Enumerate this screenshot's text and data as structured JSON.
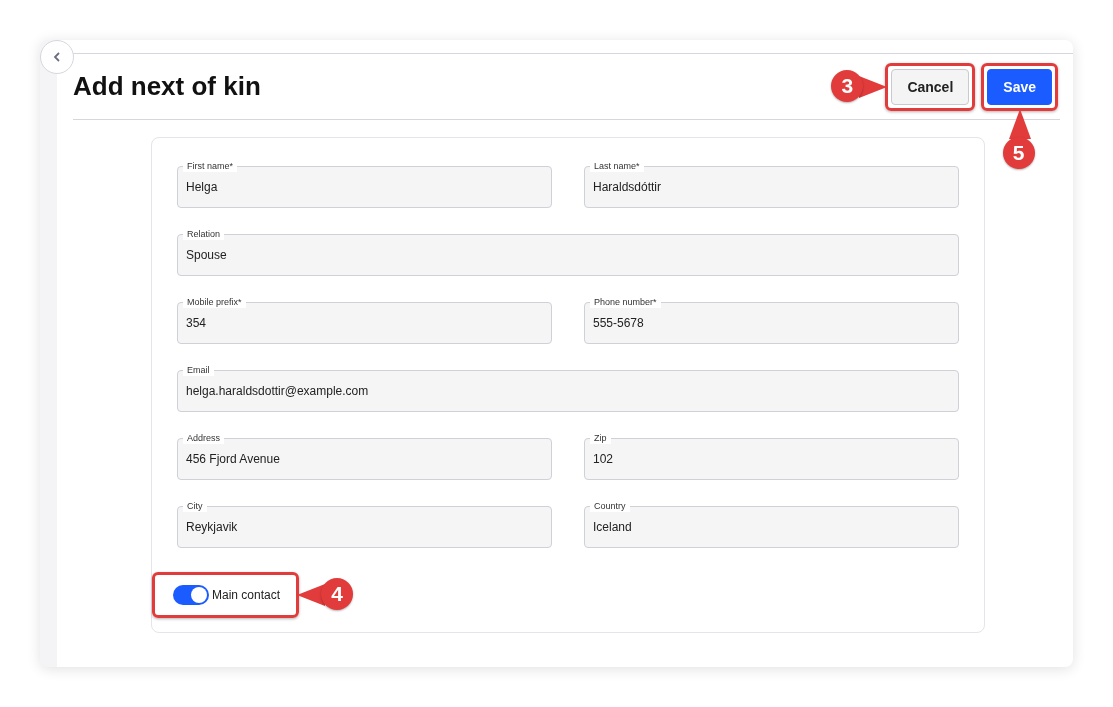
{
  "page": {
    "title": "Add next of kin"
  },
  "actions": [
    {
      "label": "Cancel",
      "kind": "secondary",
      "highlighted": true,
      "callout": {
        "number": "3"
      }
    },
    {
      "label": "Save",
      "kind": "primary",
      "highlighted": true,
      "callout": {
        "number": "5"
      }
    }
  ],
  "form": {
    "rows": [
      [
        {
          "label": "First name*",
          "value": "Helga"
        },
        {
          "label": "Last name*",
          "value": "Haraldsdóttir"
        }
      ],
      [
        {
          "label": "Relation",
          "value": "Spouse"
        }
      ],
      [
        {
          "label": "Mobile prefix*",
          "value": "354"
        },
        {
          "label": "Phone number*",
          "value": "555-5678"
        }
      ],
      [
        {
          "label": "Email",
          "value": "helga.haraldsdottir@example.com"
        }
      ],
      [
        {
          "label": "Address",
          "value": "456 Fjord Avenue"
        },
        {
          "label": "Zip",
          "value": "102"
        }
      ],
      [
        {
          "label": "City",
          "value": "Reykjavik"
        },
        {
          "label": "Country",
          "value": "Iceland"
        }
      ]
    ]
  },
  "main_contact": {
    "label": "Main contact",
    "on": true,
    "highlighted": true,
    "callout": {
      "number": "4"
    }
  }
}
